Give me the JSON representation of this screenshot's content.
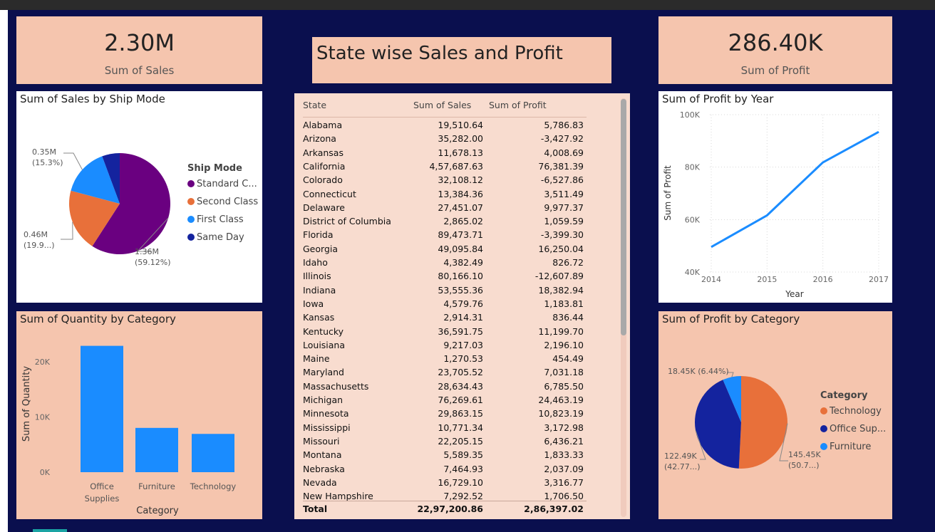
{
  "kpis": {
    "sales": {
      "value": "2.30M",
      "label": "Sum of Sales"
    },
    "profit": {
      "value": "286.40K",
      "label": "Sum of Profit"
    }
  },
  "main_title": "State wise Sales and Profit",
  "colors": {
    "panel": "#f5c5ae",
    "background": "#0a0f4e",
    "purple": "#6a0080",
    "orange": "#e8703a",
    "light_blue": "#1a8cff",
    "dark_blue": "#14239e",
    "bar_blue": "#1a8cff",
    "line_blue": "#1a8cff"
  },
  "chart_data": [
    {
      "type": "pie",
      "title": "Sum of Sales by Ship Mode",
      "legend_title": "Ship Mode",
      "legend_position": "right",
      "slices": [
        {
          "name": "Standard Class",
          "legend_label": "Standard C...",
          "value": 1.36,
          "label": "1.36M",
          "pct_label": "(59.12%)",
          "color": "#6a0080"
        },
        {
          "name": "Second Class",
          "legend_label": "Second Class",
          "value": 0.46,
          "label": "0.46M",
          "pct_label": "(19.9...)",
          "color": "#e8703a"
        },
        {
          "name": "First Class",
          "legend_label": "First Class",
          "value": 0.35,
          "label": "0.35M",
          "pct_label": "(15.3%)",
          "color": "#1a8cff"
        },
        {
          "name": "Same Day",
          "legend_label": "Same Day",
          "value": 0.13,
          "label": "",
          "pct_label": "",
          "color": "#14239e"
        }
      ]
    },
    {
      "type": "line",
      "title": "Sum of Profit by Year",
      "xlabel": "Year",
      "ylabel": "Sum of Profit",
      "x": [
        2014,
        2015,
        2016,
        2017
      ],
      "y": [
        49544,
        61619,
        81795,
        93439
      ],
      "x_ticks": [
        "2014",
        "2015",
        "2016",
        "2017"
      ],
      "y_ticks": [
        {
          "v": 40000,
          "t": "40K"
        },
        {
          "v": 60000,
          "t": "60K"
        },
        {
          "v": 80000,
          "t": "80K"
        },
        {
          "v": 100000,
          "t": "100K"
        }
      ],
      "ylim": [
        40000,
        100000
      ],
      "grid": true
    },
    {
      "type": "bar",
      "title": "Sum of Quantity by Category",
      "xlabel": "Category",
      "ylabel": "Sum of Quantity",
      "categories": [
        [
          "Office",
          "Supplies"
        ],
        [
          "Furniture"
        ],
        [
          "Technology"
        ]
      ],
      "values": [
        22906,
        8028,
        6939
      ],
      "y_ticks": [
        {
          "v": 0,
          "t": "0K"
        },
        {
          "v": 10000,
          "t": "10K"
        },
        {
          "v": 20000,
          "t": "20K"
        }
      ],
      "ylim": [
        0,
        23500
      ],
      "grid": false
    },
    {
      "type": "pie",
      "title": "Sum of Profit by Category",
      "legend_title": "Category",
      "legend_position": "right",
      "slices": [
        {
          "name": "Technology",
          "legend_label": "Technology",
          "value": 145.45,
          "label": "145.45K",
          "pct_label": "(50.7...)",
          "color": "#e8703a"
        },
        {
          "name": "Office Supplies",
          "legend_label": "Office Sup...",
          "value": 122.49,
          "label": "122.49K",
          "pct_label": "(42.77...)",
          "color": "#14239e"
        },
        {
          "name": "Furniture",
          "legend_label": "Furniture",
          "value": 18.45,
          "label": "18.45K (6.44%)",
          "pct_label": "",
          "color": "#1a8cff"
        }
      ]
    },
    {
      "type": "table",
      "title": "State wise Sales and Profit",
      "columns": [
        "State",
        "Sum of Sales",
        "Sum of Profit"
      ],
      "rows": [
        [
          "Alabama",
          "19,510.64",
          "5,786.83"
        ],
        [
          "Arizona",
          "35,282.00",
          "-3,427.92"
        ],
        [
          "Arkansas",
          "11,678.13",
          "4,008.69"
        ],
        [
          "California",
          "4,57,687.63",
          "76,381.39"
        ],
        [
          "Colorado",
          "32,108.12",
          "-6,527.86"
        ],
        [
          "Connecticut",
          "13,384.36",
          "3,511.49"
        ],
        [
          "Delaware",
          "27,451.07",
          "9,977.37"
        ],
        [
          "District of Columbia",
          "2,865.02",
          "1,059.59"
        ],
        [
          "Florida",
          "89,473.71",
          "-3,399.30"
        ],
        [
          "Georgia",
          "49,095.84",
          "16,250.04"
        ],
        [
          "Idaho",
          "4,382.49",
          "826.72"
        ],
        [
          "Illinois",
          "80,166.10",
          "-12,607.89"
        ],
        [
          "Indiana",
          "53,555.36",
          "18,382.94"
        ],
        [
          "Iowa",
          "4,579.76",
          "1,183.81"
        ],
        [
          "Kansas",
          "2,914.31",
          "836.44"
        ],
        [
          "Kentucky",
          "36,591.75",
          "11,199.70"
        ],
        [
          "Louisiana",
          "9,217.03",
          "2,196.10"
        ],
        [
          "Maine",
          "1,270.53",
          "454.49"
        ],
        [
          "Maryland",
          "23,705.52",
          "7,031.18"
        ],
        [
          "Massachusetts",
          "28,634.43",
          "6,785.50"
        ],
        [
          "Michigan",
          "76,269.61",
          "24,463.19"
        ],
        [
          "Minnesota",
          "29,863.15",
          "10,823.19"
        ],
        [
          "Mississippi",
          "10,771.34",
          "3,172.98"
        ],
        [
          "Missouri",
          "22,205.15",
          "6,436.21"
        ],
        [
          "Montana",
          "5,589.35",
          "1,833.33"
        ],
        [
          "Nebraska",
          "7,464.93",
          "2,037.09"
        ],
        [
          "Nevada",
          "16,729.10",
          "3,316.77"
        ],
        [
          "New Hampshire",
          "7,292.52",
          "1,706.50"
        ]
      ],
      "total": [
        "Total",
        "22,97,200.86",
        "2,86,397.02"
      ]
    }
  ]
}
